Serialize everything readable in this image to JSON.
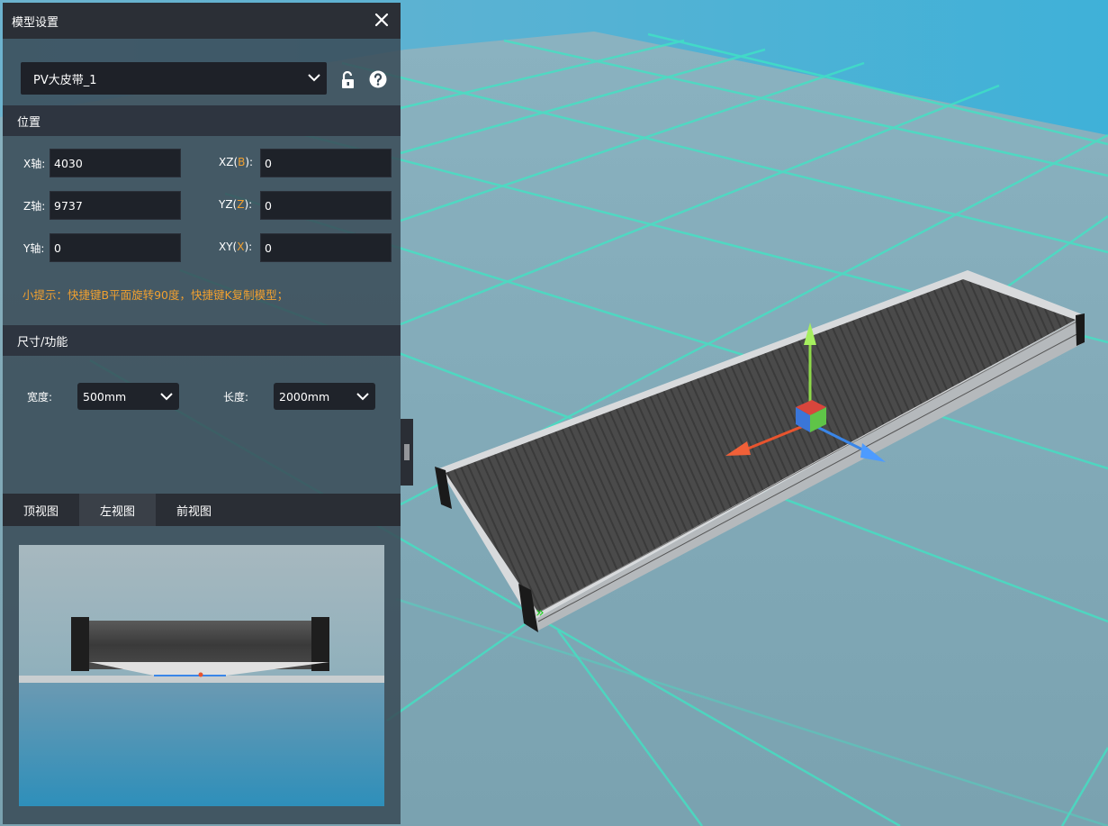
{
  "panel": {
    "title": "模型设置",
    "model_select": {
      "value": "PV大皮带_1"
    },
    "position_section": {
      "title": "位置"
    },
    "fields": {
      "x": {
        "label": "X轴:",
        "value": "4030"
      },
      "z": {
        "label": "Z轴:",
        "value": "9737"
      },
      "y": {
        "label": "Y轴:",
        "value": "0"
      },
      "xz": {
        "label_pre": "XZ(",
        "axis": "B",
        "label_post": "):",
        "value": "0"
      },
      "yz": {
        "label_pre": "YZ(",
        "axis": "Z",
        "label_post": "):",
        "value": "0"
      },
      "xy": {
        "label_pre": "XY(",
        "axis": "X",
        "label_post": "):",
        "value": "0"
      }
    },
    "hint": "小提示：快捷键B平面旋转90度，快捷键K复制模型；",
    "size_section": {
      "title": "尺寸/功能"
    },
    "width": {
      "label": "宽度:",
      "value": "500mm"
    },
    "length": {
      "label": "长度:",
      "value": "2000mm"
    },
    "tabs": [
      {
        "label": "顶视图",
        "active": false
      },
      {
        "label": "左视图",
        "active": true
      },
      {
        "label": "前视图",
        "active": false
      }
    ]
  },
  "icons": [
    "close-icon",
    "chevron-down-icon",
    "unlock-icon",
    "help-icon",
    "splitter-grip-icon"
  ],
  "colors": {
    "accent_orange": "#f0a030",
    "grid_line": "#3ee6c4",
    "panel_bg": "#394a56",
    "gizmo_x": "#e8542e",
    "gizmo_y": "#9be84a",
    "gizmo_z": "#3a86e8"
  }
}
